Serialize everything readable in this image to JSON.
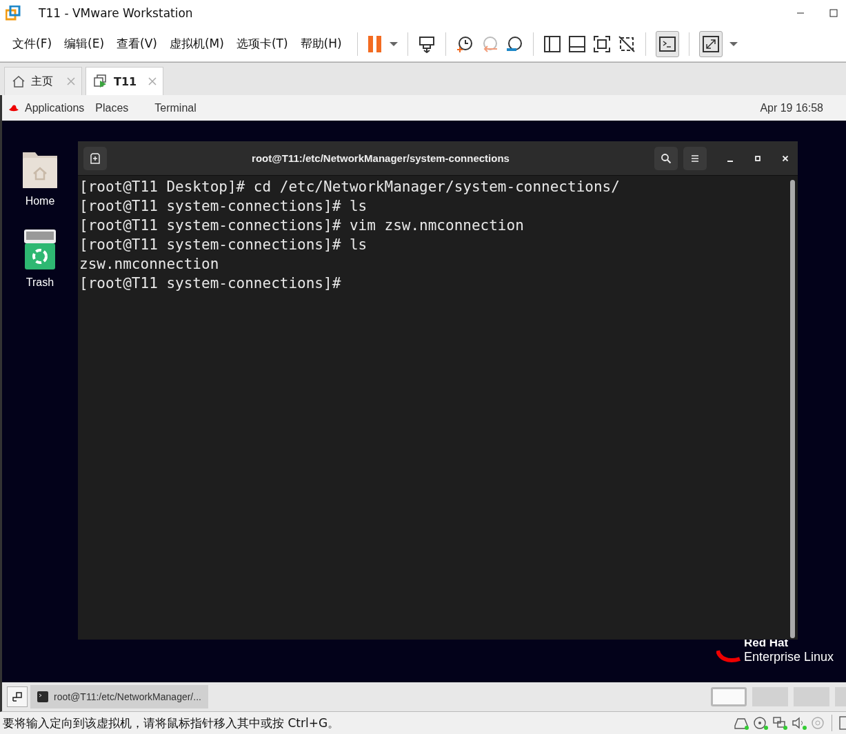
{
  "window": {
    "title": "T11 - VMware Workstation"
  },
  "menu": [
    "文件(F)",
    "编辑(E)",
    "查看(V)",
    "虚拟机(M)",
    "选项卡(T)",
    "帮助(H)"
  ],
  "toolbar_toggles": [
    {
      "kind": "console",
      "pressed": true
    },
    {
      "kind": "stretch",
      "pressed": true
    }
  ],
  "tabs": [
    {
      "label": "主页",
      "kind": "home",
      "selected": false
    },
    {
      "label": "T11",
      "kind": "vm",
      "selected": true
    }
  ],
  "guest_topbar": {
    "applications": "Applications",
    "places": "Places",
    "app": "Terminal",
    "clock": "Apr 19  16:58"
  },
  "desktop_icons": [
    {
      "label": "Home",
      "kind": "folder"
    },
    {
      "label": "Trash",
      "kind": "trash"
    }
  ],
  "terminal": {
    "title": "root@T11:/etc/NetworkManager/system-connections",
    "lines": [
      "[root@T11 Desktop]# cd /etc/NetworkManager/system-connections/",
      "[root@T11 system-connections]# ls",
      "[root@T11 system-connections]# vim zsw.nmconnection",
      "[root@T11 system-connections]# ls",
      "zsw.nmconnection",
      "[root@T11 system-connections]#"
    ]
  },
  "branding": {
    "line1": "Red Hat",
    "line2": "Enterprise Linux"
  },
  "vm_taskbar": {
    "item": "root@T11:/etc/NetworkManager/..."
  },
  "workspaces": [
    {
      "selected": true
    },
    {
      "selected": false
    },
    {
      "selected": false
    },
    {
      "selected": false
    }
  ],
  "status_bar": {
    "message": "要将输入定向到该虚拟机，请将鼠标指针移入其中或按 Ctrl+G。"
  }
}
